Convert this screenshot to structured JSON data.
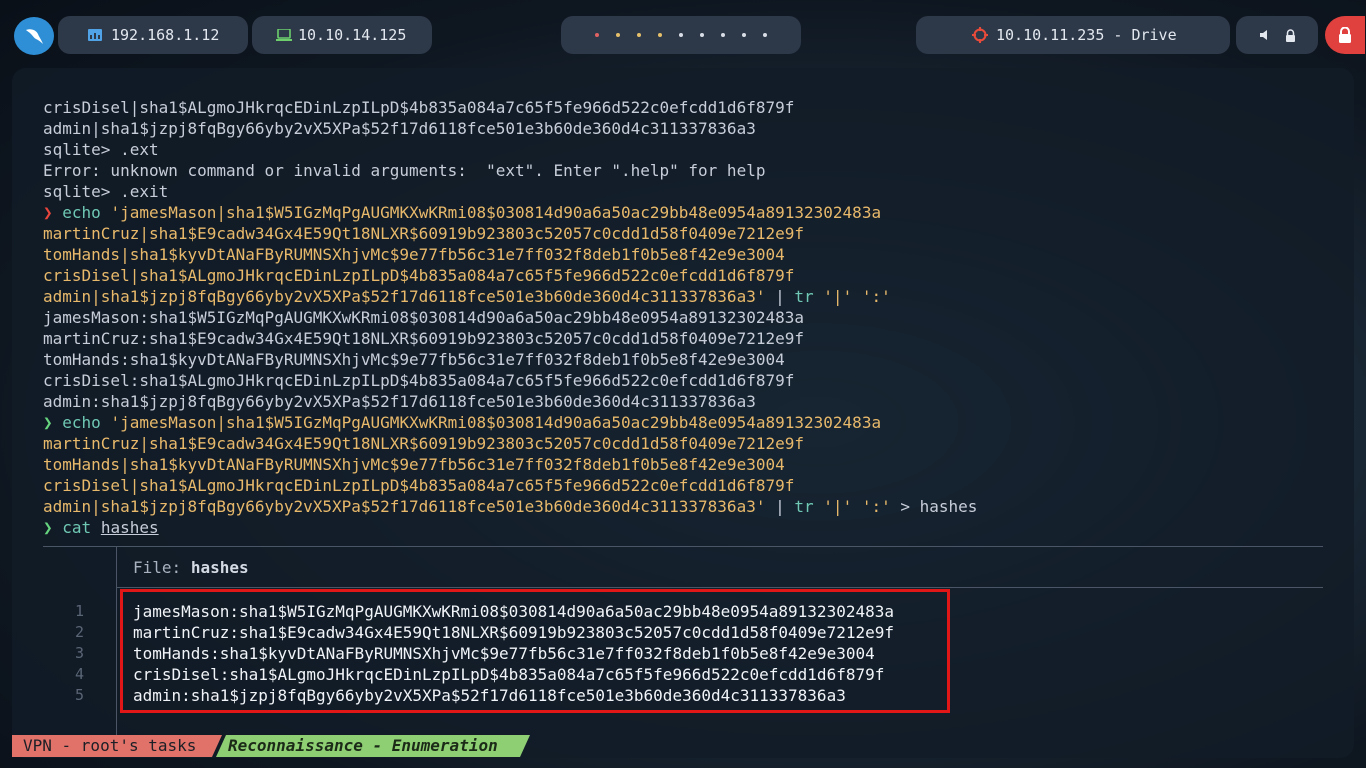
{
  "topbar": {
    "host_ip": "192.168.1.12",
    "vpn_ip": "10.10.14.125",
    "target": "10.10.11.235 - Drive"
  },
  "colors": {
    "prompt_ok": "#66d47e",
    "prompt_err": "#e8453c",
    "highlight_box": "#e11717",
    "status_vpn": "#e0726a",
    "status_task": "#8ecf73"
  },
  "terminal": {
    "lines": [
      {
        "text": "crisDisel|sha1$ALgmoJHkrqcEDinLzpILpD$4b835a084a7c65f5fe966d522c0efcdd1d6f879f"
      },
      {
        "text": "admin|sha1$jzpj8fqBgy66yby2vX5XPa$52f17d6118fce501e3b60de360d4c311337836a3"
      },
      {
        "text": "sqlite> .ext"
      },
      {
        "text": "Error: unknown command or invalid arguments:  \"ext\". Enter \".help\" for help"
      },
      {
        "text": "sqlite> .exit"
      }
    ],
    "echo1_first": "'jamesMason|sha1$W5IGzMqPgAUGMKXwKRmi08$030814d90a6a50ac29bb48e0954a89132302483a",
    "echo1_mid": [
      {
        "text": "martinCruz|sha1$E9cadw34Gx4E59Qt18NLXR$60919b923803c52057c0cdd1d58f0409e7212e9f"
      },
      {
        "text": "tomHands|sha1$kyvDtANaFByRUMNSXhjvMc$9e77fb56c31e7ff032f8deb1f0b5e8f42e9e3004"
      },
      {
        "text": "crisDisel|sha1$ALgmoJHkrqcEDinLzpILpD$4b835a084a7c65f5fe966d522c0efcdd1d6f879f"
      }
    ],
    "echo1_last": "admin|sha1$jzpj8fqBgy66yby2vX5XPa$52f17d6118fce501e3b60de360d4c311337836a3'",
    "out1": [
      {
        "text": "jamesMason:sha1$W5IGzMqPgAUGMKXwKRmi08$030814d90a6a50ac29bb48e0954a89132302483a"
      },
      {
        "text": "martinCruz:sha1$E9cadw34Gx4E59Qt18NLXR$60919b923803c52057c0cdd1d58f0409e7212e9f"
      },
      {
        "text": "tomHands:sha1$kyvDtANaFByRUMNSXhjvMc$9e77fb56c31e7ff032f8deb1f0b5e8f42e9e3004"
      },
      {
        "text": "crisDisel:sha1$ALgmoJHkrqcEDinLzpILpD$4b835a084a7c65f5fe966d522c0efcdd1d6f879f"
      },
      {
        "text": "admin:sha1$jzpj8fqBgy66yby2vX5XPa$52f17d6118fce501e3b60de360d4c311337836a3"
      }
    ],
    "echo_cmd": "echo",
    "tr_cmd": "tr",
    "tr_args": "'|' ':'",
    "redirect": "> hashes",
    "cat_cmd": "cat",
    "cat_arg": "hashes"
  },
  "bat": {
    "label": "File:",
    "filename": "hashes",
    "line_numbers": [
      "1",
      "2",
      "3",
      "4",
      "5"
    ],
    "lines": [
      {
        "text": "jamesMason:sha1$W5IGzMqPgAUGMKXwKRmi08$030814d90a6a50ac29bb48e0954a89132302483a"
      },
      {
        "text": "martinCruz:sha1$E9cadw34Gx4E59Qt18NLXR$60919b923803c52057c0cdd1d58f0409e7212e9f"
      },
      {
        "text": "tomHands:sha1$kyvDtANaFByRUMNSXhjvMc$9e77fb56c31e7ff032f8deb1f0b5e8f42e9e3004"
      },
      {
        "text": "crisDisel:sha1$ALgmoJHkrqcEDinLzpILpD$4b835a084a7c65f5fe966d522c0efcdd1d6f879f"
      },
      {
        "text": "admin:sha1$jzpj8fqBgy66yby2vX5XPa$52f17d6118fce501e3b60de360d4c311337836a3"
      }
    ]
  },
  "statusbar": {
    "vpn_label": "VPN - root's tasks",
    "task_label": "Reconnaissance - Enumeration"
  }
}
